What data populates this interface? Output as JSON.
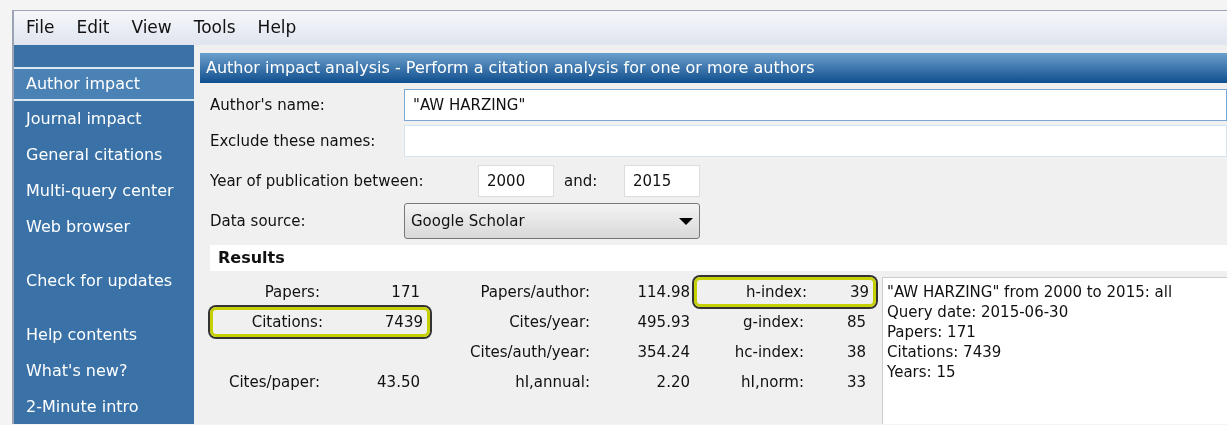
{
  "menu": [
    "File",
    "Edit",
    "View",
    "Tools",
    "Help"
  ],
  "sidebar": {
    "groups": [
      [
        {
          "label": "Author impact",
          "selected": true
        },
        {
          "label": "Journal impact",
          "selected": false
        },
        {
          "label": "General citations",
          "selected": false
        },
        {
          "label": "Multi-query center",
          "selected": false
        },
        {
          "label": "Web browser",
          "selected": false
        }
      ],
      [
        {
          "label": "Check for updates",
          "selected": false
        }
      ],
      [
        {
          "label": "Help contents",
          "selected": false
        },
        {
          "label": "What's new?",
          "selected": false
        },
        {
          "label": "2-Minute intro",
          "selected": false
        }
      ]
    ]
  },
  "header": "Author impact analysis - Perform a citation analysis for one or more authors",
  "form": {
    "author_label": "Author's name:",
    "author_value": "\"AW HARZING\"",
    "exclude_label": "Exclude these names:",
    "year_label": "Year of publication between:",
    "year_from": "2000",
    "and_label": "and:",
    "year_to": "2015",
    "source_label": "Data source:",
    "source_value": "Google Scholar"
  },
  "results": {
    "title": "Results",
    "columns": [
      [
        {
          "label": "Papers:",
          "value": "171",
          "highlighted": false
        },
        {
          "label": "Citations:",
          "value": "7439",
          "highlighted": true
        },
        null,
        {
          "label": "Cites/paper:",
          "value": "43.50",
          "highlighted": false
        }
      ],
      [
        {
          "label": "Papers/author:",
          "value": "114.98",
          "highlighted": false
        },
        {
          "label": "Cites/year:",
          "value": "495.93",
          "highlighted": false
        },
        {
          "label": "Cites/auth/year:",
          "value": "354.24",
          "highlighted": false
        },
        {
          "label": "hI,annual:",
          "value": "2.20",
          "highlighted": false
        }
      ],
      [
        {
          "label": "h-index:",
          "value": "39",
          "highlighted": true
        },
        {
          "label": "g-index:",
          "value": "85",
          "highlighted": false
        },
        {
          "label": "hc-index:",
          "value": "38",
          "highlighted": false
        },
        {
          "label": "hI,norm:",
          "value": "33",
          "highlighted": false
        }
      ]
    ],
    "summary": [
      "\"AW HARZING\" from 2000 to 2015: all",
      "Query date: 2015-06-30",
      "Papers: 171",
      "Citations: 7439",
      "Years: 15"
    ]
  }
}
